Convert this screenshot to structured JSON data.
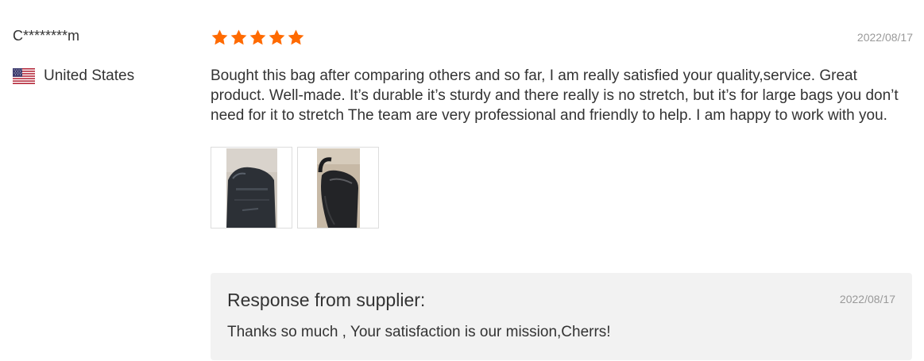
{
  "reviewer": {
    "name": "C********m",
    "country": "United States",
    "flag_icon": "us-flag-icon"
  },
  "review": {
    "rating": 5,
    "max_rating": 5,
    "star_color": "#ff6a00",
    "date": "2022/08/17",
    "text": "Bought this bag after comparing others and so far, I am really satisfied your quality,service. Great product. Well-made. It’s durable it’s sturdy and there really is no stretch, but it’s for large bags you don’t need for it to stretch The team are very professional and friendly to help. I am happy to work with you.",
    "photos": [
      {
        "icon": "review-photo-thumbnail"
      },
      {
        "icon": "review-photo-thumbnail"
      }
    ]
  },
  "response": {
    "title": "Response from supplier:",
    "date": "2022/08/17",
    "text": "Thanks so much , Your satisfaction is our mission,Cherrs!"
  }
}
